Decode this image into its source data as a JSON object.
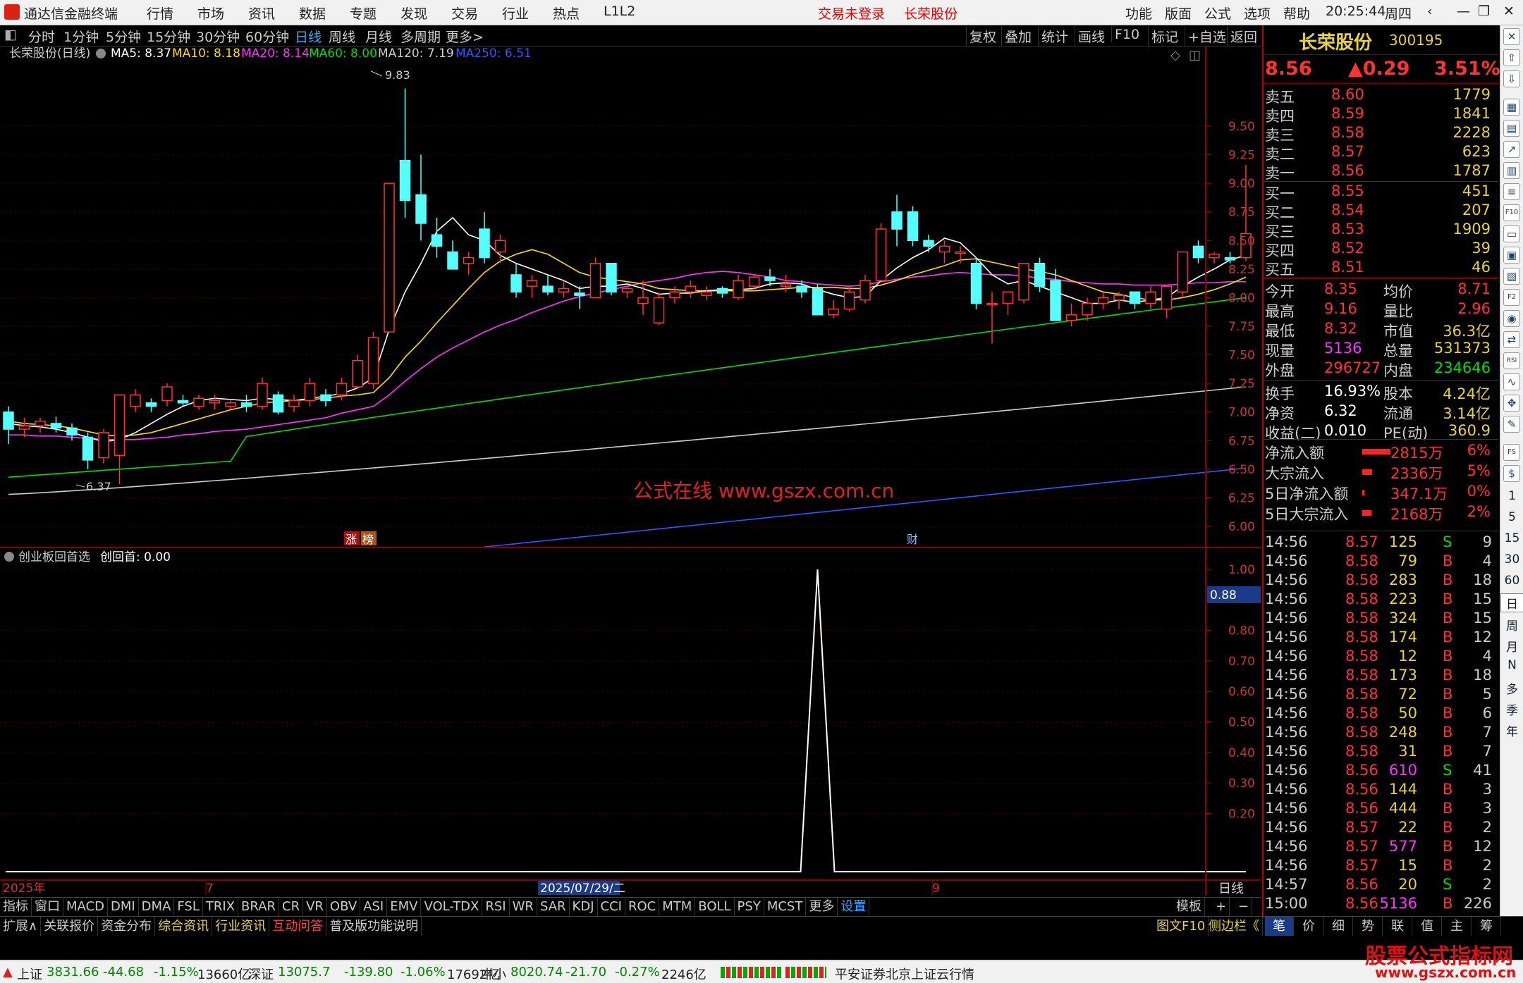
{
  "titlebar": {
    "app": "通达信金融终端",
    "menus": [
      "行情",
      "市场",
      "资讯",
      "数据",
      "专题",
      "发现",
      "交易",
      "行业",
      "热点",
      "L1L2"
    ],
    "login": "交易未登录",
    "stock": "长荣股份",
    "right_menus": [
      "功能",
      "版面",
      "公式",
      "选项",
      "帮助"
    ],
    "time": "20:25:44",
    "weekday": "周四"
  },
  "tfbar": {
    "periods": [
      "分时",
      "1分钟",
      "5分钟",
      "15分钟",
      "30分钟",
      "60分钟",
      "日线",
      "周线",
      "月线",
      "多周期",
      "更多>"
    ],
    "active": "日线",
    "right": [
      "复权",
      "叠加",
      "统计",
      "画线",
      "F10",
      "标记",
      "+自选",
      "返回"
    ]
  },
  "info": {
    "name": "长荣股份(日线)",
    "ma5": "MA5: 8.37",
    "ma10": "MA10: 8.18",
    "ma20": "MA20: 8.14",
    "ma60": "MA60: 8.00",
    "ma120": "MA120: 7.19",
    "ma250": "MA250: 6.51",
    "colors": {
      "ma5": "#ffffff",
      "ma10": "#ffdd00",
      "ma20": "#ff33ff",
      "ma60": "#00dd00",
      "ma120": "#cccccc",
      "ma250": "#3355ff"
    }
  },
  "chart": {
    "high_label": "9.83",
    "low_label": "6.37",
    "y_ticks": [
      "9.50",
      "9.25",
      "9.00",
      "8.75",
      "8.50",
      "8.25",
      "8.00",
      "7.75",
      "7.50",
      "7.25",
      "7.00",
      "6.75",
      "6.50",
      "6.25",
      "6.00"
    ],
    "watermark": "公式在线 www.gszx.com.cn",
    "marker1": "涨",
    "marker2": "榜",
    "marker3": "财"
  },
  "indicator": {
    "name": "创业板回首选",
    "value": "创回首: 0.00",
    "y_ticks": [
      "1.00",
      "0.80",
      "0.70",
      "0.60",
      "0.50",
      "0.40",
      "0.30",
      "0.20"
    ],
    "cursor_value": "0.88"
  },
  "xaxis": {
    "labels": [
      "2025年",
      "7",
      "2025/07/29/二",
      "9"
    ],
    "right_label": "日线"
  },
  "botbar1": {
    "items": [
      "指标",
      "窗口",
      "MACD",
      "DMI",
      "DMA",
      "FSL",
      "TRIX",
      "BRAR",
      "CR",
      "VR",
      "OBV",
      "ASI",
      "EMV",
      "VOL-TDX",
      "RSI",
      "WR",
      "SAR",
      "KDJ",
      "CCI",
      "ROC",
      "MTM",
      "BOLL",
      "PSY",
      "MCST",
      "更多",
      "设置"
    ],
    "right": [
      "模板",
      "+",
      "−"
    ]
  },
  "botbar2": {
    "items": [
      "扩展∧",
      "关联报价",
      "资金分布",
      "综合资讯",
      "行业资讯",
      "互动问答",
      "普及版功能说明"
    ],
    "right": [
      "图文F10",
      "侧边栏《"
    ],
    "tabs": [
      "笔",
      "价",
      "细",
      "势",
      "联",
      "值",
      "主",
      "筹"
    ]
  },
  "quote": {
    "name": "长荣股份",
    "code": "300195",
    "price": "8.56",
    "change": "▲0.29",
    "pct": "3.51%",
    "asks": [
      [
        "卖五",
        "8.60",
        "1779"
      ],
      [
        "卖四",
        "8.59",
        "1841"
      ],
      [
        "卖三",
        "8.58",
        "2228"
      ],
      [
        "卖二",
        "8.57",
        "623"
      ],
      [
        "卖一",
        "8.56",
        "1787"
      ]
    ],
    "bids": [
      [
        "买一",
        "8.55",
        "451"
      ],
      [
        "买二",
        "8.54",
        "207"
      ],
      [
        "买三",
        "8.53",
        "1909"
      ],
      [
        "买四",
        "8.52",
        "39"
      ],
      [
        "买五",
        "8.51",
        "46"
      ]
    ],
    "stats": [
      [
        "今开",
        "8.35",
        "均价",
        "8.71"
      ],
      [
        "最高",
        "9.16",
        "量比",
        "2.96"
      ],
      [
        "最低",
        "8.32",
        "市值",
        "36.3亿"
      ],
      [
        "现量",
        "5136",
        "总量",
        "531373"
      ],
      [
        "外盘",
        "296727",
        "内盘",
        "234646"
      ]
    ],
    "stats2": [
      [
        "换手",
        "16.93%",
        "股本",
        "4.24亿"
      ],
      [
        "净资",
        "6.32",
        "流通",
        "3.14亿"
      ],
      [
        "收益(二)",
        "0.010",
        "PE(动)",
        "360.9"
      ]
    ],
    "flows": [
      [
        "净流入额",
        "2815万",
        "6%"
      ],
      [
        "大宗流入",
        "2336万",
        "5%"
      ],
      [
        "5日净流入额",
        "347.1万",
        "0%"
      ],
      [
        "5日大宗流入",
        "2168万",
        "2%"
      ]
    ],
    "ticks": [
      [
        "14:56",
        "8.57",
        "125",
        "S",
        "9"
      ],
      [
        "14:56",
        "8.58",
        "79",
        "B",
        "4"
      ],
      [
        "14:56",
        "8.58",
        "283",
        "B",
        "18"
      ],
      [
        "14:56",
        "8.58",
        "223",
        "B",
        "15"
      ],
      [
        "14:56",
        "8.58",
        "324",
        "B",
        "15"
      ],
      [
        "14:56",
        "8.58",
        "174",
        "B",
        "12"
      ],
      [
        "14:56",
        "8.58",
        "12",
        "B",
        "4"
      ],
      [
        "14:56",
        "8.58",
        "173",
        "B",
        "18"
      ],
      [
        "14:56",
        "8.58",
        "72",
        "B",
        "5"
      ],
      [
        "14:56",
        "8.58",
        "50",
        "B",
        "6"
      ],
      [
        "14:56",
        "8.58",
        "248",
        "B",
        "7"
      ],
      [
        "14:56",
        "8.58",
        "31",
        "B",
        "7"
      ],
      [
        "14:56",
        "8.56",
        "610",
        "S",
        "41"
      ],
      [
        "14:56",
        "8.56",
        "144",
        "B",
        "3"
      ],
      [
        "14:56",
        "8.56",
        "444",
        "B",
        "3"
      ],
      [
        "14:56",
        "8.57",
        "22",
        "B",
        "2"
      ],
      [
        "14:56",
        "8.57",
        "577",
        "B",
        "12"
      ],
      [
        "14:56",
        "8.57",
        "15",
        "B",
        "2"
      ],
      [
        "14:57",
        "8.56",
        "20",
        "S",
        "2"
      ],
      [
        "15:00",
        "8.56",
        "5136",
        "B",
        "226"
      ]
    ]
  },
  "sideicons": {
    "letters": [
      "RSI",
      "F10",
      "F2",
      "FS"
    ],
    "periods": [
      "1",
      "5",
      "15",
      "30",
      "60",
      "日",
      "周",
      "月",
      "N",
      "多",
      "季",
      "年"
    ]
  },
  "statusbar": {
    "sh_name": "上证",
    "sh": "3831.66",
    "sh_chg": "-44.68",
    "sh_pct": "-1.15%",
    "sh_vol": "13660亿",
    "sz_name": "深证",
    "sz": "13075.7",
    "sz_chg": "-139.80",
    "sz_pct": "-1.06%",
    "sz_vol": "17692亿",
    "zx_name": "中小",
    "zx": "8020.74",
    "zx_chg": "-21.70",
    "zx_pct": "-0.27%",
    "zx_vol": "2246亿",
    "broker": "平安证券北京上证云行情"
  },
  "footer_watermark": {
    "title": "股票公式指标网",
    "url": "www.gszx.com.cn"
  },
  "chart_data": {
    "type": "candlestick",
    "ylim": [
      6.0,
      9.7
    ],
    "candles": [
      [
        7.0,
        7.05,
        6.72,
        6.85
      ],
      [
        6.85,
        6.95,
        6.78,
        6.88
      ],
      [
        6.88,
        6.95,
        6.82,
        6.92
      ],
      [
        6.9,
        6.96,
        6.82,
        6.86
      ],
      [
        6.86,
        6.9,
        6.75,
        6.8
      ],
      [
        6.78,
        6.82,
        6.5,
        6.58
      ],
      [
        6.6,
        6.85,
        6.55,
        6.82
      ],
      [
        6.62,
        7.15,
        6.37,
        7.15
      ],
      [
        7.05,
        7.2,
        7.0,
        7.15
      ],
      [
        7.08,
        7.12,
        7.0,
        7.05
      ],
      [
        7.1,
        7.25,
        7.05,
        7.22
      ],
      [
        7.1,
        7.15,
        7.05,
        7.08
      ],
      [
        7.05,
        7.15,
        7.02,
        7.12
      ],
      [
        7.08,
        7.15,
        7.02,
        7.1
      ],
      [
        7.05,
        7.1,
        7.02,
        7.08
      ],
      [
        7.08,
        7.15,
        7.0,
        7.05
      ],
      [
        7.05,
        7.3,
        7.02,
        7.25
      ],
      [
        7.15,
        7.18,
        6.98,
        7.0
      ],
      [
        7.05,
        7.15,
        7.0,
        7.1
      ],
      [
        7.1,
        7.3,
        7.05,
        7.25
      ],
      [
        7.15,
        7.2,
        7.05,
        7.1
      ],
      [
        7.15,
        7.3,
        7.1,
        7.25
      ],
      [
        7.22,
        7.5,
        7.2,
        7.45
      ],
      [
        7.25,
        7.7,
        7.2,
        7.65
      ],
      [
        7.7,
        9.0,
        7.7,
        9.0
      ],
      [
        9.2,
        9.83,
        8.7,
        8.85
      ],
      [
        8.9,
        9.25,
        8.5,
        8.65
      ],
      [
        8.55,
        8.7,
        8.35,
        8.45
      ],
      [
        8.4,
        8.5,
        8.25,
        8.25
      ],
      [
        8.3,
        8.4,
        8.2,
        8.35
      ],
      [
        8.6,
        8.75,
        8.3,
        8.35
      ],
      [
        8.4,
        8.55,
        8.3,
        8.5
      ],
      [
        8.2,
        8.3,
        8.0,
        8.05
      ],
      [
        8.1,
        8.2,
        8.0,
        8.15
      ],
      [
        8.1,
        8.2,
        8.02,
        8.05
      ],
      [
        8.05,
        8.15,
        8.0,
        8.08
      ],
      [
        8.04,
        8.1,
        7.9,
        8.02
      ],
      [
        8.0,
        8.35,
        8.0,
        8.3
      ],
      [
        8.3,
        8.3,
        8.02,
        8.05
      ],
      [
        8.05,
        8.1,
        8.0,
        8.08
      ],
      [
        7.95,
        8.15,
        7.85,
        8.0
      ],
      [
        7.78,
        8.05,
        7.76,
        8.0
      ],
      [
        8.0,
        8.1,
        7.95,
        8.05
      ],
      [
        8.05,
        8.15,
        8.0,
        8.1
      ],
      [
        8.02,
        8.1,
        7.98,
        8.05
      ],
      [
        8.08,
        8.1,
        8.0,
        8.04
      ],
      [
        8.0,
        8.2,
        7.98,
        8.15
      ],
      [
        8.1,
        8.2,
        8.05,
        8.18
      ],
      [
        8.18,
        8.25,
        8.1,
        8.15
      ],
      [
        8.1,
        8.2,
        8.05,
        8.12
      ],
      [
        8.1,
        8.15,
        8.0,
        8.05
      ],
      [
        8.08,
        8.12,
        7.85,
        7.85
      ],
      [
        7.85,
        7.98,
        7.82,
        7.9
      ],
      [
        7.9,
        8.1,
        7.88,
        8.05
      ],
      [
        7.98,
        8.2,
        7.95,
        8.15
      ],
      [
        8.15,
        8.65,
        8.15,
        8.6
      ],
      [
        8.75,
        8.9,
        8.45,
        8.6
      ],
      [
        8.75,
        8.8,
        8.45,
        8.5
      ],
      [
        8.5,
        8.55,
        8.4,
        8.45
      ],
      [
        8.4,
        8.5,
        8.3,
        8.45
      ],
      [
        8.4,
        8.45,
        8.3,
        8.4
      ],
      [
        8.3,
        8.35,
        7.9,
        7.95
      ],
      [
        7.95,
        8.05,
        7.6,
        7.95
      ],
      [
        7.95,
        8.05,
        7.85,
        8.05
      ],
      [
        7.98,
        8.3,
        7.95,
        8.3
      ],
      [
        8.3,
        8.35,
        8.05,
        8.1
      ],
      [
        8.15,
        8.25,
        7.8,
        7.8
      ],
      [
        7.8,
        7.95,
        7.75,
        7.85
      ],
      [
        7.85,
        8.0,
        7.8,
        7.95
      ],
      [
        7.95,
        8.05,
        7.9,
        8.0
      ],
      [
        7.98,
        8.05,
        7.9,
        8.02
      ],
      [
        8.05,
        8.05,
        7.9,
        7.95
      ],
      [
        7.95,
        8.1,
        7.9,
        8.05
      ],
      [
        7.9,
        8.1,
        7.82,
        8.1
      ],
      [
        8.05,
        8.4,
        8.0,
        8.4
      ],
      [
        8.45,
        8.5,
        8.3,
        8.35
      ],
      [
        8.35,
        8.4,
        8.3,
        8.38
      ],
      [
        8.35,
        8.4,
        8.3,
        8.33
      ],
      [
        8.35,
        9.16,
        8.32,
        8.56
      ]
    ],
    "ma5": [
      6.9,
      6.88,
      6.87,
      6.85,
      6.82,
      6.78,
      6.74,
      6.76,
      6.82,
      6.9,
      6.98,
      7.05,
      7.1,
      7.12,
      7.11,
      7.1,
      7.12,
      7.11,
      7.1,
      7.12,
      7.14,
      7.16,
      7.21,
      7.3,
      7.72,
      8.05,
      8.3,
      8.58,
      8.7,
      8.55,
      8.5,
      8.37,
      8.3,
      8.25,
      8.2,
      8.15,
      8.08,
      8.1,
      8.1,
      8.12,
      8.08,
      8.03,
      8.04,
      8.04,
      8.06,
      8.07,
      8.07,
      8.08,
      8.12,
      8.13,
      8.12,
      8.07,
      8.03,
      8.0,
      8.01,
      8.15,
      8.26,
      8.35,
      8.42,
      8.52,
      8.48,
      8.35,
      8.2,
      8.12,
      8.15,
      8.1,
      8.05,
      8.0,
      7.95,
      7.95,
      7.98,
      7.96,
      7.98,
      8.0,
      8.1,
      8.18,
      8.25,
      8.33,
      8.37
    ],
    "ma10": [
      6.92,
      6.9,
      6.89,
      6.88,
      6.86,
      6.83,
      6.8,
      6.79,
      6.8,
      6.82,
      6.86,
      6.9,
      6.94,
      6.98,
      7.02,
      7.05,
      7.08,
      7.09,
      7.1,
      7.11,
      7.12,
      7.14,
      7.15,
      7.17,
      7.3,
      7.48,
      7.62,
      7.78,
      7.93,
      8.08,
      8.22,
      8.32,
      8.38,
      8.42,
      8.38,
      8.3,
      8.22,
      8.18,
      8.16,
      8.14,
      8.12,
      8.08,
      8.07,
      8.06,
      8.06,
      8.06,
      8.06,
      8.06,
      8.07,
      8.08,
      8.09,
      8.09,
      8.09,
      8.08,
      8.08,
      8.11,
      8.15,
      8.2,
      8.24,
      8.28,
      8.33,
      8.34,
      8.31,
      8.28,
      8.25,
      8.23,
      8.2,
      8.15,
      8.1,
      8.05,
      8.03,
      8.0,
      7.98,
      7.98,
      8.0,
      8.03,
      8.07,
      8.12,
      8.18
    ],
    "ma20": [
      6.8,
      6.8,
      6.79,
      6.79,
      6.78,
      6.77,
      6.76,
      6.76,
      6.76,
      6.77,
      6.78,
      6.8,
      6.81,
      6.83,
      6.84,
      6.85,
      6.87,
      6.89,
      6.91,
      6.93,
      6.95,
      6.99,
      7.02,
      7.05,
      7.15,
      7.27,
      7.38,
      7.48,
      7.56,
      7.63,
      7.7,
      7.76,
      7.81,
      7.87,
      7.92,
      7.97,
      8.01,
      8.04,
      8.07,
      8.1,
      8.13,
      8.15,
      8.17,
      8.2,
      8.22,
      8.23,
      8.22,
      8.2,
      8.18,
      8.15,
      8.14,
      8.12,
      8.11,
      8.1,
      8.11,
      8.14,
      8.16,
      8.18,
      8.19,
      8.21,
      8.22,
      8.21,
      8.2,
      8.2,
      8.19,
      8.17,
      8.16,
      8.14,
      8.13,
      8.12,
      8.12,
      8.11,
      8.11,
      8.11,
      8.12,
      8.13,
      8.13,
      8.14,
      8.14
    ]
  },
  "indicator_data": {
    "type": "line",
    "ylim": [
      0,
      1.0
    ],
    "spike_index": 51,
    "spike_value": 1.0
  }
}
